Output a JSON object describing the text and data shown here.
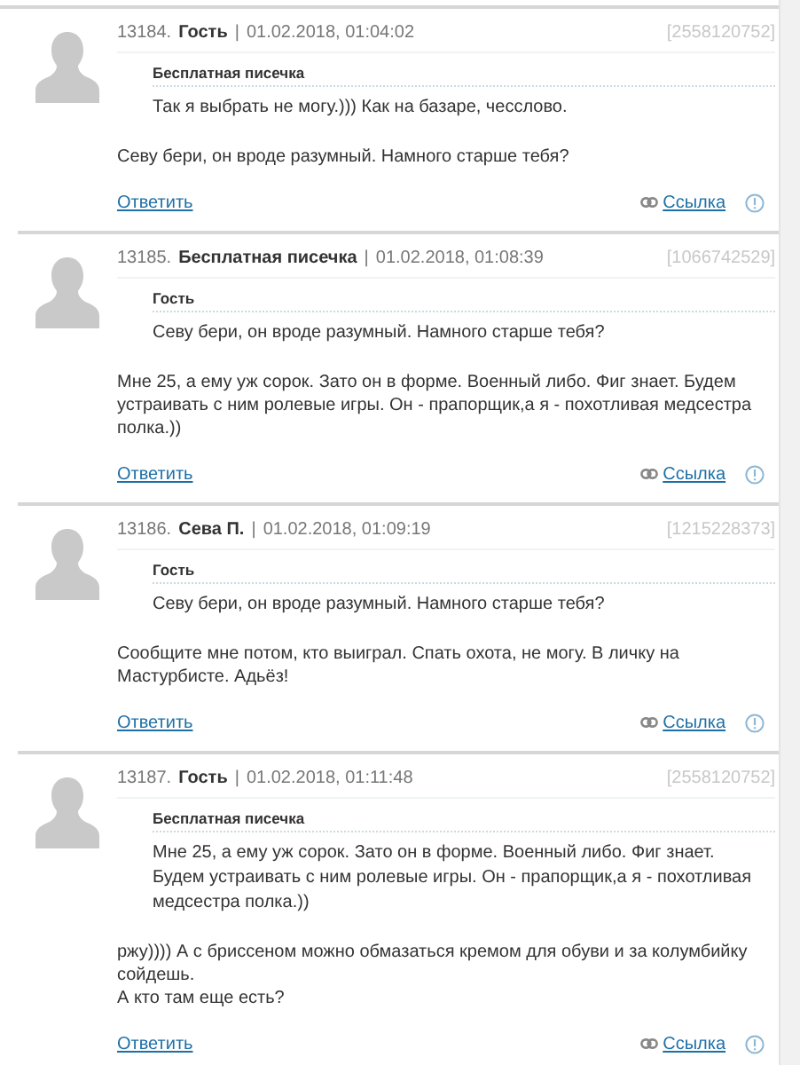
{
  "separator": "|",
  "comments": [
    {
      "number": "13184.",
      "author": "Гость",
      "date": "01.02.2018, 01:04:02",
      "ip": "[2558120752]",
      "quote": {
        "author": "Бесплатная писечка",
        "text": "Так я выбрать не могу.))) Как на базаре, чесслово."
      },
      "text": "Севу бери, он вроде разумный. Намного старше тебя?",
      "reply": "Ответить",
      "link": "Ссылка"
    },
    {
      "number": "13185.",
      "author": "Бесплатная писечка",
      "date": "01.02.2018, 01:08:39",
      "ip": "[1066742529]",
      "quote": {
        "author": "Гость",
        "text": "Севу бери, он вроде разумный. Намного старше тебя?"
      },
      "text": "Мне 25, а ему уж сорок. Зато он в форме. Военный либо. Фиг знает. Будем устраивать с ним ролевые игры. Он - прапорщик,а я - похотливая медсестра полка.))",
      "reply": "Ответить",
      "link": "Ссылка"
    },
    {
      "number": "13186.",
      "author": "Сева П.",
      "date": "01.02.2018, 01:09:19",
      "ip": "[1215228373]",
      "quote": {
        "author": "Гость",
        "text": "Севу бери, он вроде разумный. Намного старше тебя?"
      },
      "text": "Сообщите мне потом, кто выиграл. Спать охота, не могу. В личку на Мастурбисте. Адьёз!",
      "reply": "Ответить",
      "link": "Ссылка"
    },
    {
      "number": "13187.",
      "author": "Гость",
      "date": "01.02.2018, 01:11:48",
      "ip": "[2558120752]",
      "quote": {
        "author": "Бесплатная писечка",
        "text": "Мне 25, а ему уж сорок. Зато он в форме. Военный либо. Фиг знает. Будем устраивать с ним ролевые игры. Он - прапорщик,а я - похотливая медсестра полка.))"
      },
      "text": "ржу)))) А с бриссеном можно обмазаться кремом для обуви и за колумбийку сойдешь.\nА кто там еще есть?",
      "reply": "Ответить",
      "link": "Ссылка"
    }
  ]
}
